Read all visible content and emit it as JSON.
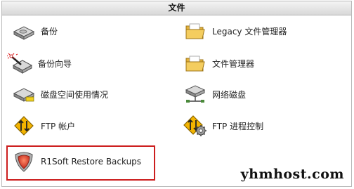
{
  "header": {
    "title": "文件"
  },
  "items": [
    {
      "label": "备份",
      "icon": "backup-disk-icon"
    },
    {
      "label": "Legacy 文件管理器",
      "icon": "legacy-folder-icon"
    },
    {
      "label": "备份向导",
      "icon": "backup-wizard-icon"
    },
    {
      "label": "文件管理器",
      "icon": "folder-icon"
    },
    {
      "label": "磁盘空间使用情况",
      "icon": "disk-usage-icon"
    },
    {
      "label": "网络磁盘",
      "icon": "network-disk-icon"
    },
    {
      "label": "FTP 帐户",
      "icon": "ftp-account-icon"
    },
    {
      "label": "FTP 进程控制",
      "icon": "ftp-process-gear-icon"
    },
    {
      "label": "R1Soft Restore Backups",
      "icon": "r1soft-shield-icon"
    }
  ],
  "watermark": "yhmhost.com",
  "colors": {
    "highlight_border": "#cc1e1e",
    "ftp_arrow": "#f0b000"
  }
}
